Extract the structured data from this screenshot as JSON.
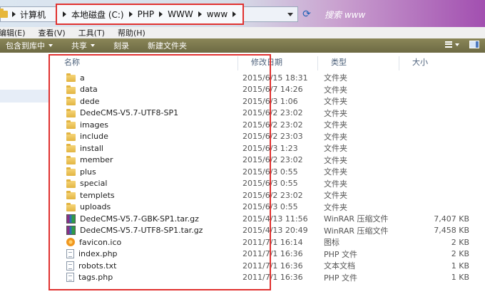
{
  "address": {
    "breadcrumbs": [
      "计算机",
      "本地磁盘 (C:)",
      "PHP",
      "WWW",
      "www"
    ],
    "search_placeholder": "搜索 www"
  },
  "menu": [
    "编辑(E)",
    "查看(V)",
    "工具(T)",
    "帮助(H)"
  ],
  "toolbar": {
    "include_in_library": "包含到库中",
    "share": "共享",
    "burn": "刻录",
    "new_folder": "新建文件夹"
  },
  "columns": {
    "name": "名称",
    "date": "修改日期",
    "type": "类型",
    "size": "大小"
  },
  "files": [
    {
      "name": "a",
      "date": "2015/6/15 18:31",
      "type": "文件夹",
      "size": "",
      "icon": "folder-icon"
    },
    {
      "name": "data",
      "date": "2015/6/7 14:26",
      "type": "文件夹",
      "size": "",
      "icon": "folder-icon"
    },
    {
      "name": "dede",
      "date": "2015/6/3 1:06",
      "type": "文件夹",
      "size": "",
      "icon": "folder-icon"
    },
    {
      "name": "DedeCMS-V5.7-UTF8-SP1",
      "date": "2015/6/2 23:02",
      "type": "文件夹",
      "size": "",
      "icon": "folder-icon"
    },
    {
      "name": "images",
      "date": "2015/6/2 23:02",
      "type": "文件夹",
      "size": "",
      "icon": "folder-icon"
    },
    {
      "name": "include",
      "date": "2015/6/2 23:03",
      "type": "文件夹",
      "size": "",
      "icon": "folder-icon"
    },
    {
      "name": "install",
      "date": "2015/6/3 1:23",
      "type": "文件夹",
      "size": "",
      "icon": "folder-icon"
    },
    {
      "name": "member",
      "date": "2015/6/2 23:02",
      "type": "文件夹",
      "size": "",
      "icon": "folder-icon"
    },
    {
      "name": "plus",
      "date": "2015/6/3 0:55",
      "type": "文件夹",
      "size": "",
      "icon": "folder-icon"
    },
    {
      "name": "special",
      "date": "2015/6/3 0:55",
      "type": "文件夹",
      "size": "",
      "icon": "folder-icon"
    },
    {
      "name": "templets",
      "date": "2015/6/2 23:02",
      "type": "文件夹",
      "size": "",
      "icon": "folder-icon"
    },
    {
      "name": "uploads",
      "date": "2015/6/3 0:55",
      "type": "文件夹",
      "size": "",
      "icon": "folder-icon"
    },
    {
      "name": "DedeCMS-V5.7-GBK-SP1.tar.gz",
      "date": "2015/4/13 11:56",
      "type": "WinRAR 压缩文件",
      "size": "7,407 KB",
      "icon": "winrar-archive-icon"
    },
    {
      "name": "DedeCMS-V5.7-UTF8-SP1.tar.gz",
      "date": "2015/4/13 20:49",
      "type": "WinRAR 压缩文件",
      "size": "7,458 KB",
      "icon": "winrar-archive-icon"
    },
    {
      "name": "favicon.ico",
      "date": "2011/7/1 16:14",
      "type": "图标",
      "size": "2 KB",
      "icon": "ico-file-icon"
    },
    {
      "name": "index.php",
      "date": "2011/7/1 16:36",
      "type": "PHP 文件",
      "size": "2 KB",
      "icon": "document-icon"
    },
    {
      "name": "robots.txt",
      "date": "2011/7/1 16:36",
      "type": "文本文档",
      "size": "1 KB",
      "icon": "document-icon"
    },
    {
      "name": "tags.php",
      "date": "2011/7/1 16:36",
      "type": "PHP 文件",
      "size": "1 KB",
      "icon": "document-icon"
    }
  ],
  "colors": {
    "highlight": "#e0312f",
    "toolbar": "#7c7950",
    "header_text": "#4c607a"
  }
}
